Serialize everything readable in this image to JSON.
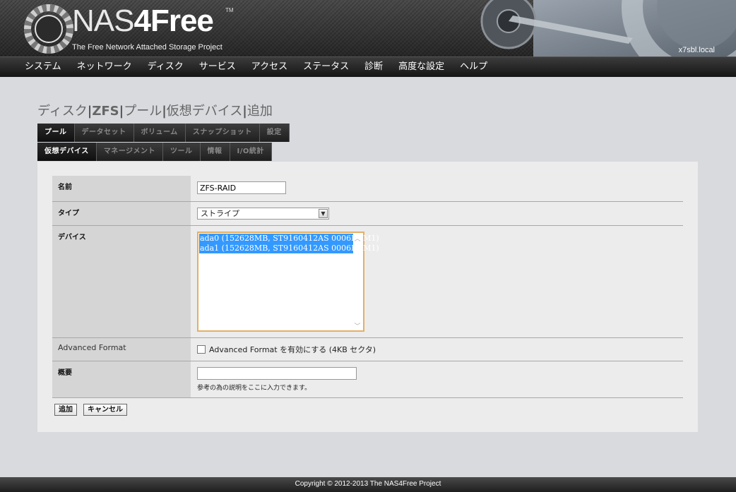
{
  "header": {
    "logo_prefix": "NAS",
    "logo_suffix": "4Free",
    "logo_tm": "TM",
    "subtitle": "The Free Network Attached Storage Project",
    "hostname": "x7sbl.local"
  },
  "nav": {
    "items": [
      "システム",
      "ネットワーク",
      "ディスク",
      "サービス",
      "アクセス",
      "ステータス",
      "診断",
      "高度な設定",
      "ヘルプ"
    ]
  },
  "page_title": {
    "part1": "ディスク",
    "sep": "|",
    "part2": "ZFS",
    "part3": "プール",
    "part4": "仮想デバイス",
    "part5": "追加"
  },
  "tabs_row1": [
    {
      "label": "プール",
      "active": true
    },
    {
      "label": "データセット",
      "active": false
    },
    {
      "label": "ボリューム",
      "active": false
    },
    {
      "label": "スナップショット",
      "active": false
    },
    {
      "label": "設定",
      "active": false
    }
  ],
  "tabs_row2": [
    {
      "label": "仮想デバイス",
      "active": true
    },
    {
      "label": "マネージメント",
      "active": false
    },
    {
      "label": "ツール",
      "active": false
    },
    {
      "label": "情報",
      "active": false
    },
    {
      "label": "I/O統計",
      "active": false
    }
  ],
  "form": {
    "name": {
      "label": "名前",
      "value": "ZFS-RAID"
    },
    "type": {
      "label": "タイプ",
      "selected": "ストライプ"
    },
    "devices": {
      "label": "デバイス",
      "options": [
        "ada0 (152628MB, ST9160412AS 0006HPM1)",
        "ada1 (152628MB, ST9160412AS 0006HPM1)"
      ]
    },
    "advanced": {
      "label": "Advanced Format",
      "checkbox_label": "Advanced Format を有効にする (4KB セクタ)",
      "checked": false
    },
    "desc": {
      "label": "概要",
      "value": "",
      "hint": "参考の為の説明をここに入力できます。"
    }
  },
  "buttons": {
    "add": "追加",
    "cancel": "キャンセル"
  },
  "footer": {
    "copyright": "Copyright © 2012-2013 The NAS4Free Project"
  }
}
